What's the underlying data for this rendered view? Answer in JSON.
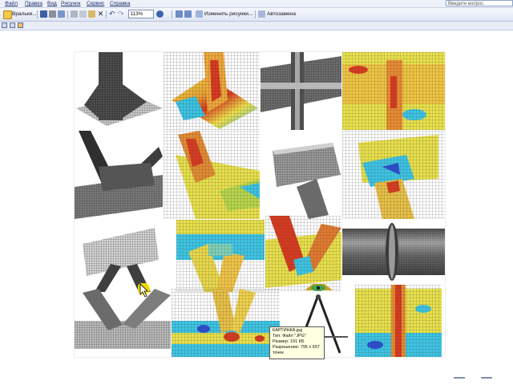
{
  "menu": {
    "items": [
      "Файл",
      "Правка",
      "Вид",
      "Рисунок",
      "Сервис",
      "Справка"
    ],
    "ask_placeholder": "Введите вопрос"
  },
  "toolbar": {
    "insert_label": "Вральки...",
    "zoom_value": "113%",
    "change_pictures_label": "Изменить рисунки...",
    "autoreplace_label": "Автозамена"
  },
  "tooltip": {
    "lines": [
      "КАРТИНКА.jpg",
      "Тип: Файл \"JPG\"",
      "Размер: 191 КБ",
      "Разрешение: 795 x 657",
      "точек"
    ]
  },
  "colors": {
    "menu_bg": "#eef1fa",
    "fea_red": "#d83a1e",
    "fea_yellow": "#f2e04a",
    "fea_cyan": "#3cc4e4",
    "fea_blue": "#2a4fd0",
    "mesh_gray": "#9a9a9a"
  },
  "icons": [
    "open-icon",
    "save-icon",
    "print-icon",
    "preview-icon",
    "cut-icon",
    "copy-icon",
    "paste-icon",
    "delete-icon",
    "undo-icon",
    "redo-icon",
    "help-icon",
    "rotate-left-icon",
    "rotate-right-icon",
    "thumbnail-view-icon",
    "filmstrip-view-icon",
    "single-view-icon",
    "pointer-cursor-icon",
    "mason-compass-icon"
  ]
}
